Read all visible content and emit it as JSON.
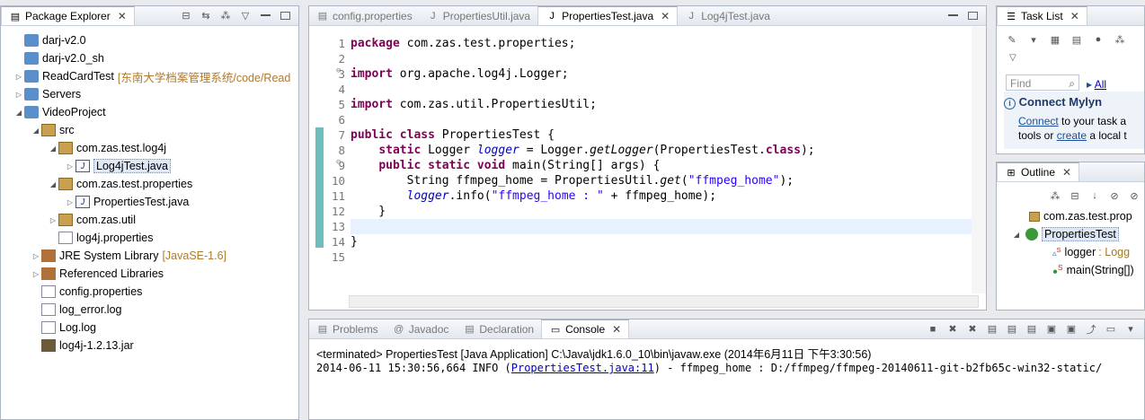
{
  "package_explorer": {
    "title": "Package Explorer",
    "items": [
      {
        "label": "darj-v2.0",
        "depth": 0,
        "arrow": "",
        "icon": "folder"
      },
      {
        "label": "darj-v2.0_sh",
        "depth": 0,
        "arrow": "",
        "icon": "folder"
      },
      {
        "label": "ReadCardTest",
        "deco": "[东南大学档案管理系统/code/Read",
        "depth": 0,
        "arrow": "▷",
        "icon": "project"
      },
      {
        "label": "Servers",
        "depth": 0,
        "arrow": "▷",
        "icon": "folder"
      },
      {
        "label": "VideoProject",
        "depth": 0,
        "arrow": "◢",
        "icon": "project"
      },
      {
        "label": "src",
        "depth": 1,
        "arrow": "◢",
        "icon": "srcfolder"
      },
      {
        "label": "com.zas.test.log4j",
        "depth": 2,
        "arrow": "◢",
        "icon": "pkg"
      },
      {
        "label": "Log4jTest.java",
        "depth": 3,
        "arrow": "▷",
        "icon": "java",
        "selected": true
      },
      {
        "label": "com.zas.test.properties",
        "depth": 2,
        "arrow": "◢",
        "icon": "pkg"
      },
      {
        "label": "PropertiesTest.java",
        "depth": 3,
        "arrow": "▷",
        "icon": "java"
      },
      {
        "label": "com.zas.util",
        "depth": 2,
        "arrow": "▷",
        "icon": "pkg"
      },
      {
        "label": "log4j.properties",
        "depth": 2,
        "arrow": "",
        "icon": "file"
      },
      {
        "label": "JRE System Library",
        "deco": "[JavaSE-1.6]",
        "depth": 1,
        "arrow": "▷",
        "icon": "lib"
      },
      {
        "label": "Referenced Libraries",
        "depth": 1,
        "arrow": "▷",
        "icon": "lib"
      },
      {
        "label": "config.properties",
        "depth": 1,
        "arrow": "",
        "icon": "file"
      },
      {
        "label": "log_error.log",
        "depth": 1,
        "arrow": "",
        "icon": "file"
      },
      {
        "label": "Log.log",
        "depth": 1,
        "arrow": "",
        "icon": "file"
      },
      {
        "label": "log4j-1.2.13.jar",
        "depth": 1,
        "arrow": "",
        "icon": "jar"
      }
    ]
  },
  "editor": {
    "tabs": [
      {
        "label": "config.properties",
        "active": false
      },
      {
        "label": "PropertiesUtil.java",
        "active": false
      },
      {
        "label": "PropertiesTest.java",
        "active": true
      },
      {
        "label": "Log4jTest.java",
        "active": false
      }
    ],
    "line_numbers": [
      "1",
      "2",
      "3",
      "4",
      "5",
      "6",
      "7",
      "8",
      "9",
      "10",
      "11",
      "12",
      "13",
      "14",
      "15"
    ],
    "fold_markers": {
      "3": "⊖",
      "9": "⊖"
    }
  },
  "task_list": {
    "title": "Task List",
    "find_placeholder": "Find",
    "all_label": "All",
    "mylyn_title": "Connect Mylyn",
    "mylyn_line1_link": "Connect",
    "mylyn_line1_rest": "to your task a",
    "mylyn_line2_pre": "tools or",
    "mylyn_line2_link": "create",
    "mylyn_line2_rest": "a local t"
  },
  "outline": {
    "title": "Outline",
    "package": "com.zas.test.prop",
    "class": "PropertiesTest",
    "field": "logger",
    "field_type": ": Logg",
    "method": "main(String[])"
  },
  "console": {
    "tabs": [
      "Problems",
      "Javadoc",
      "Declaration",
      "Console"
    ],
    "active_tab": "Console",
    "terminated_line": "<terminated> PropertiesTest [Java Application] C:\\Java\\jdk1.6.0_10\\bin\\javaw.exe (2014年6月11日 下午3:30:56)",
    "log_prefix": "2014-06-11 15:30:56,664  INFO (",
    "log_link": "PropertiesTest.java:11",
    "log_suffix": ") - ffmpeg_home : D:/ffmpeg/ffmpeg-20140611-git-b2fb65c-win32-static/"
  }
}
